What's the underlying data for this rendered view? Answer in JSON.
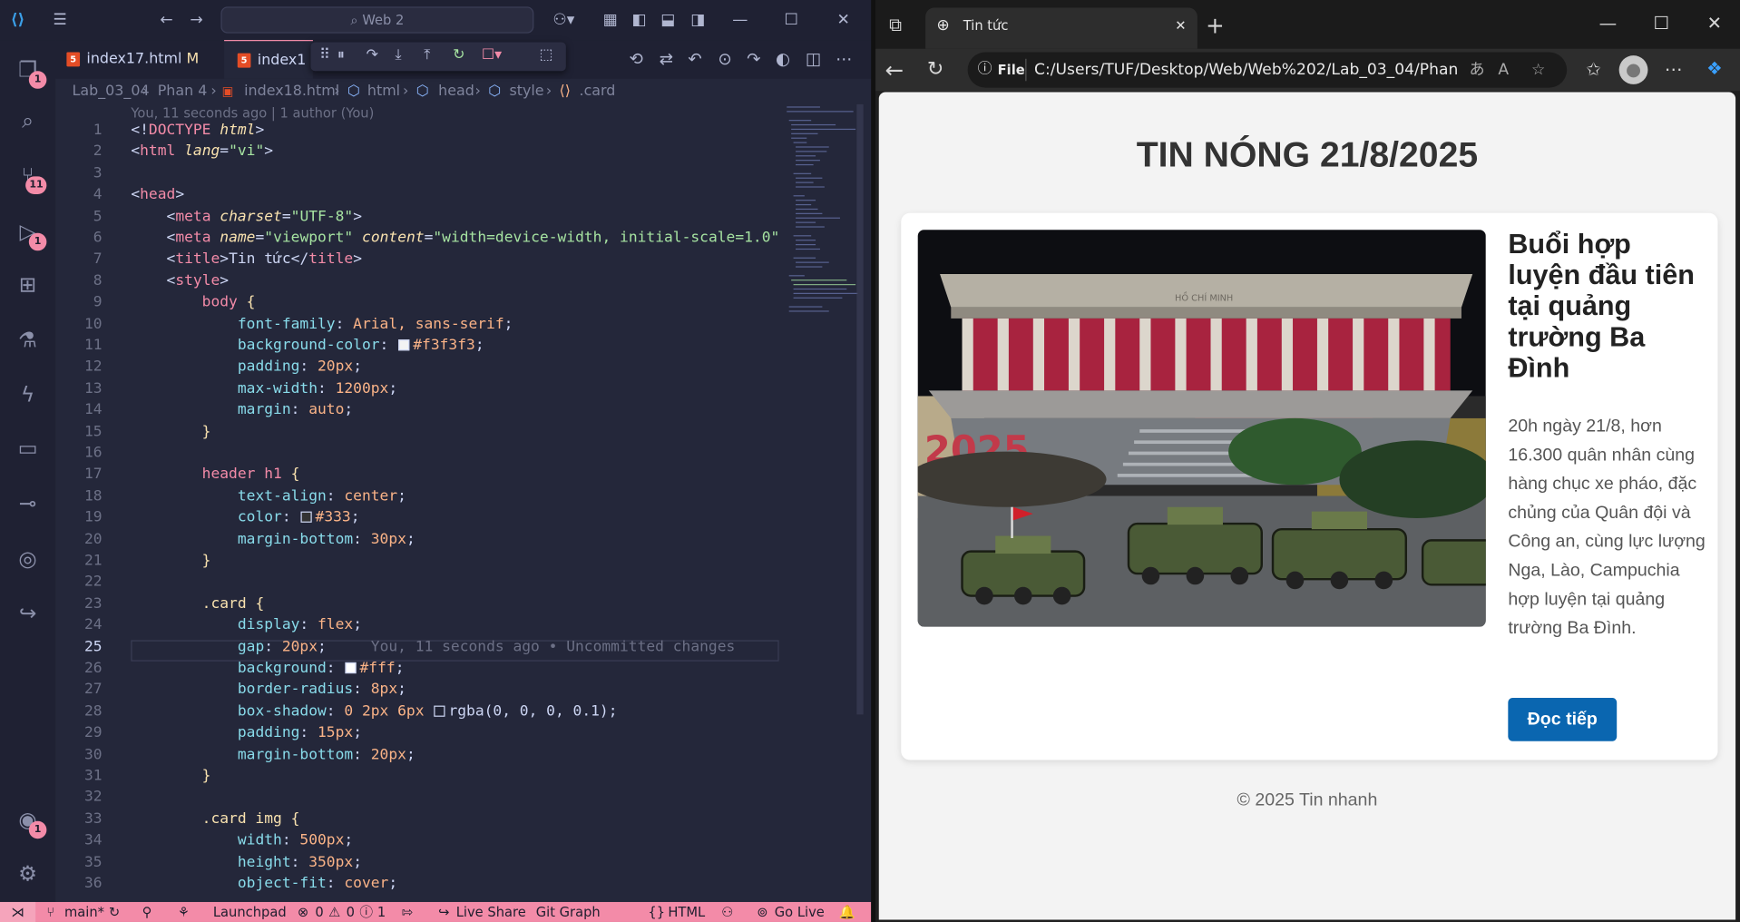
{
  "vscode": {
    "command_center": "Web 2",
    "tabs": [
      {
        "label": "index17.html",
        "modified": "M"
      },
      {
        "label": "index1"
      }
    ],
    "breadcrumb": [
      "Lab_03_04",
      "Phan 4",
      "index18.html",
      "html",
      "head",
      "style",
      ".card"
    ],
    "blame_header": "You, 11 seconds ago | 1 author (You)",
    "inline_blame": "You, 11 seconds ago • Uncommitted changes",
    "current_line": 25,
    "activity_badges": {
      "explorer": "1",
      "source_control": "11",
      "run_debug": "1",
      "accounts": "1"
    },
    "status": {
      "branch": "main*",
      "launchpad": "Launchpad",
      "errors": "0",
      "warnings": "0",
      "info": "1",
      "live_share": "Live Share",
      "git_graph": "Git Graph",
      "language": "HTML",
      "go_live": "Go Live"
    },
    "line_numbers": [
      "1",
      "2",
      "3",
      "4",
      "5",
      "6",
      "7",
      "8",
      "9",
      "10",
      "11",
      "12",
      "13",
      "14",
      "15",
      "16",
      "17",
      "18",
      "19",
      "20",
      "21",
      "22",
      "23",
      "24",
      "25",
      "26",
      "27",
      "28",
      "29",
      "30",
      "31",
      "32",
      "33",
      "34",
      "35",
      "36"
    ],
    "code": {
      "l1a": "<!",
      "l1b": "DOCTYPE",
      "l1c": " html",
      "l1d": ">",
      "l2a": "<",
      "l2b": "html",
      "l2c": " lang",
      "l2d": "=",
      "l2e": "\"vi\"",
      "l2f": ">",
      "l4": "head",
      "l5_attr": "charset",
      "l5_val": "\"UTF-8\"",
      "l6_name": "name",
      "l6_nameval": "\"viewport\"",
      "l6_content": "content",
      "l6_contentval": "\"width=device-width, initial-scale=1.0\"",
      "l7_title": "title",
      "l7_text": "Tin tức",
      "l8": "style",
      "l9": "body",
      "l10_p": "font-family",
      "l10_v": "Arial, sans-serif",
      "l11_p": "background-color",
      "l11_v": "#f3f3f3",
      "l12_p": "padding",
      "l12_v": "20px",
      "l13_p": "max-width",
      "l13_v": "1200px",
      "l14_p": "margin",
      "l14_v": "auto",
      "l17": "header h1",
      "l18_p": "text-align",
      "l18_v": "center",
      "l19_p": "color",
      "l19_v": "#333",
      "l20_p": "margin-bottom",
      "l20_v": "30px",
      "l23": ".card",
      "l24_p": "display",
      "l24_v": "flex",
      "l25_p": "gap",
      "l25_v": "20px",
      "l26_p": "background",
      "l26_v": "#fff",
      "l27_p": "border-radius",
      "l27_v": "8px",
      "l28_p": "box-shadow",
      "l28_v1": "0 2px 6px",
      "l28_v2": "rgba(0, 0, 0, 0.1)",
      "l29_p": "padding",
      "l29_v": "15px",
      "l30_p": "margin-bottom",
      "l30_v": "20px",
      "l33": ".card img",
      "l34_p": "width",
      "l34_v": "500px",
      "l35_p": "height",
      "l35_v": "350px",
      "l36_p": "object-fit",
      "l36_v": "cover"
    }
  },
  "browser": {
    "tab_title": "Tin tức",
    "scheme_chip": "File",
    "url": "C:/Users/TUF/Desktop/Web/Web%202/Lab_03_04/Phan%...",
    "page": {
      "heading": "TIN NÓNG 21/8/2025",
      "card": {
        "title": "Buổi hợp luyện đầu tiên tại quảng trường Ba Đình",
        "description": "20h ngày 21/8, hơn 16.300 quân nhân cùng hàng chục xe pháo, đặc chủng của Quân đội và Công an, cùng lực lượng Nga, Lào, Campuchia hợp luyện tại quảng trường Ba Đình.",
        "button": "Đọc tiếp",
        "photo_sign": "HỒ CHÍ MINH",
        "photo_banner_year": "2025"
      },
      "footer": "© 2025 Tin nhanh"
    }
  },
  "colors": {
    "status_bar": "#f38ba8",
    "button": "#0a66b0",
    "page_bg": "#f3f3f3"
  }
}
